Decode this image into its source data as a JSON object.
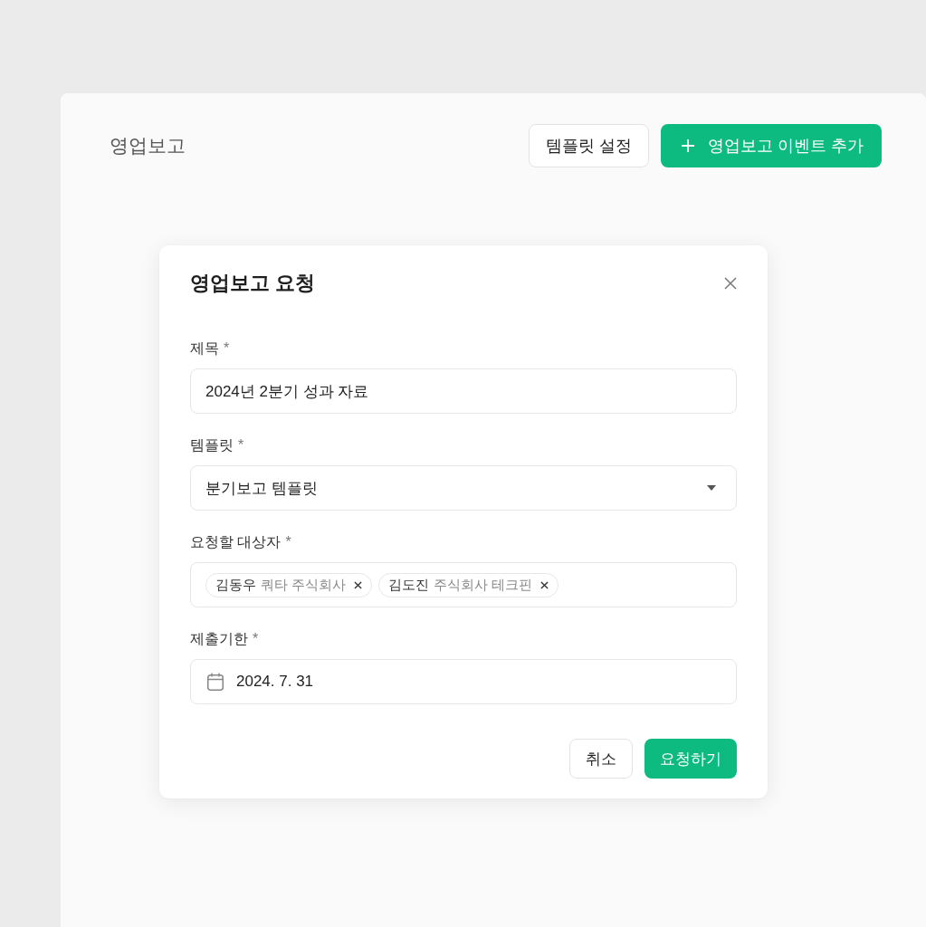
{
  "page": {
    "title": "영업보고"
  },
  "header_buttons": [
    {
      "kind": "secondary",
      "label": "템플릿 설정"
    },
    {
      "kind": "add",
      "label": "영업보고 이벤트 추가"
    }
  ],
  "dialog": {
    "title": "영업보고 요청",
    "fields": [
      {
        "kind": "text",
        "label": "제목",
        "mark": "*",
        "value": "2024년 2분기 성과 자료"
      },
      {
        "kind": "select",
        "label": "템플릿",
        "mark": "*",
        "value": "분기보고 템플릿"
      },
      {
        "kind": "tags",
        "label": "요청할 대상자",
        "mark": "*",
        "tags": [
          {
            "name": "김동우",
            "company": "쿼타 주식회사"
          },
          {
            "name": "김도진",
            "company": "주식회사 테크핀"
          }
        ]
      },
      {
        "kind": "date",
        "label": "제출기한",
        "mark": "*",
        "value": "2024. 7. 31"
      }
    ],
    "buttons": [
      {
        "kind": "secondary",
        "label": "취소"
      },
      {
        "kind": "primary",
        "label": "요청하기"
      }
    ]
  }
}
